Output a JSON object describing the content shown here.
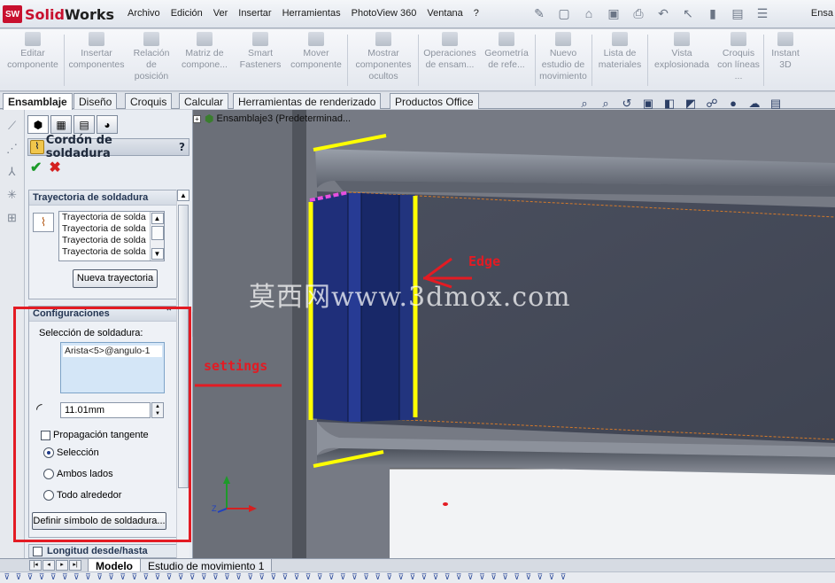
{
  "app": {
    "logo_prefix": "Solid",
    "logo_suffix": "Works",
    "window_title": "Ensa"
  },
  "menu": [
    "Archivo",
    "Edición",
    "Ver",
    "Insertar",
    "Herramientas",
    "PhotoView 360",
    "Ventana",
    "?"
  ],
  "commands": [
    {
      "icon": "assembly-component-icon",
      "label": "Editar componente"
    },
    {
      "icon": "insert-component-icon",
      "label": "Insertar componentes"
    },
    {
      "icon": "mate-icon",
      "label": "Relación de posición"
    },
    {
      "icon": "pattern-icon",
      "label": "Matriz de compone..."
    },
    {
      "icon": "smart-fastener-icon",
      "label": "Smart Fasteners"
    },
    {
      "icon": "move-component-icon",
      "label": "Mover componente"
    },
    {
      "icon": "show-hidden-icon",
      "label": "Mostrar componentes ocultos"
    },
    {
      "icon": "assembly-feature-icon",
      "label": "Operaciones de ensam..."
    },
    {
      "icon": "reference-geometry-icon",
      "label": "Geometría de refe..."
    },
    {
      "icon": "motion-study-icon",
      "label": "Nuevo estudio de movimiento"
    },
    {
      "icon": "bom-icon",
      "label": "Lista de materiales"
    },
    {
      "icon": "exploded-view-icon",
      "label": "Vista explosionada"
    },
    {
      "icon": "sketch-lines-icon",
      "label": "Croquis con líneas ..."
    },
    {
      "icon": "instant3d-icon",
      "label": "Instant 3D"
    }
  ],
  "tabs": [
    "Ensamblaje",
    "Diseño",
    "Croquis",
    "Calcular",
    "Herramientas de renderizado",
    "Productos Office"
  ],
  "property_manager": {
    "title": "Cordón de soldadura",
    "help": "?",
    "ok": "✔",
    "cancel": "✖",
    "trajectory": {
      "heading": "Trayectoria de soldadura",
      "items": [
        "Trayectoria de solda",
        "Trayectoria de solda",
        "Trayectoria de solda",
        "Trayectoria de solda"
      ],
      "new_button": "Nueva trayectoria"
    },
    "settings": {
      "heading": "Configuraciones",
      "selection_label": "Selección de soldadura:",
      "selected_item": "Arista<5>@angulo-1",
      "size_value": "11.01mm",
      "tangent_propagation": "Propagación tangente",
      "radio_selection": "Selección",
      "radio_both_sides": "Ambos lados",
      "radio_all_around": "Todo alrededor",
      "weld_symbol_button": "Definir símbolo de soldadura..."
    },
    "length_group": "Longitud desde/hasta"
  },
  "tree": {
    "root": "Ensamblaje3  (Predeterminad..."
  },
  "bottom_tabs": [
    "Modelo",
    "Estudio de movimiento 1"
  ],
  "annotations": {
    "settings": "settings",
    "edge": "Edge",
    "watermark": "莫西网www.3dmox.com"
  },
  "colors": {
    "highlight": "#ffff00",
    "annotation": "#e31b23",
    "face": "#1a2f8a",
    "beam": "#4a4f5e"
  }
}
